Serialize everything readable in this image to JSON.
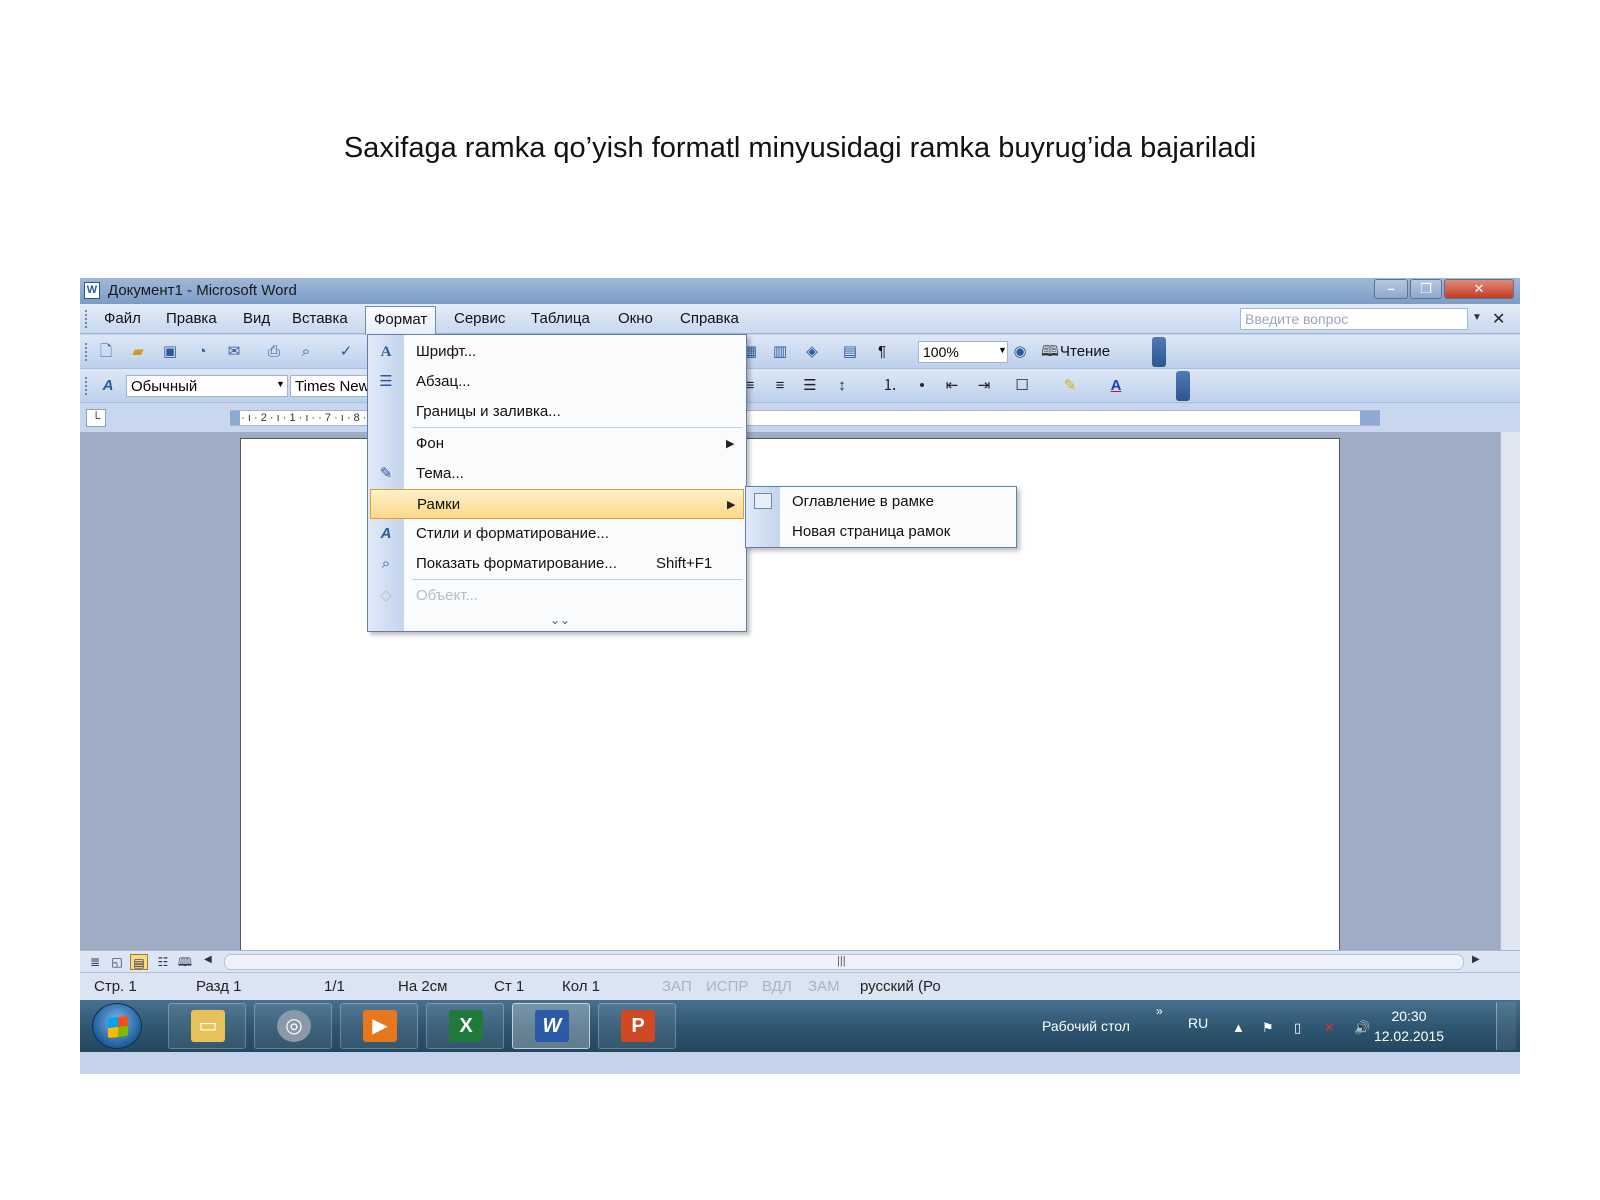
{
  "caption": "Saxifaga ramka qo’yish formatl minyusidagi ramka buyrug’ida bajariladi",
  "window": {
    "title": "Документ1 - Microsoft Word",
    "buttons": {
      "minimize": "–",
      "maximize": "❐",
      "close": "✕"
    }
  },
  "menubar": {
    "items": [
      "Файл",
      "Правка",
      "Вид",
      "Вставка",
      "Формат",
      "Сервис",
      "Таблица",
      "Окно",
      "Справка"
    ],
    "active": "Формат",
    "help_placeholder": "Введите вопрос"
  },
  "toolbar_standard": {
    "zoom": "100%",
    "reading_label": "Чтение",
    "icons": [
      "new-document",
      "open",
      "save",
      "permission",
      "email",
      "print",
      "print-preview",
      "spelling",
      "table",
      "columns",
      "drawing",
      "document-map",
      "show-formatting",
      "help"
    ]
  },
  "toolbar_formatting": {
    "style": "Обычный",
    "font": "Times New Roman",
    "icons": [
      "styles",
      "align-right",
      "justify",
      "line-spacing",
      "numbering",
      "bullets",
      "decrease-indent",
      "increase-indent",
      "borders",
      "highlight",
      "font-color"
    ]
  },
  "ruler": {
    "text": "3 · ı · 2 · ı · 1 · ı ·                                                                                         · 7 · ı · 8 · ı · 9 · ı · 10 · ı · 11 · ı · 12 · ı · 13 · ı · 14 · ı · 15 · ı · 16 · △ · 17 · ı ·"
  },
  "format_menu": {
    "items": [
      {
        "label": "Шрифт...",
        "icon": "font-icon"
      },
      {
        "label": "Абзац...",
        "icon": "paragraph-icon"
      },
      {
        "label": "Границы и заливка...",
        "icon": ""
      },
      {
        "label": "Фон",
        "icon": "",
        "submenu": true
      },
      {
        "label": "Тема...",
        "icon": "theme-icon"
      },
      {
        "label": "Рамки",
        "icon": "",
        "submenu": true,
        "highlighted": true
      },
      {
        "label": "Стили и форматирование...",
        "icon": "styles-icon"
      },
      {
        "label": "Показать форматирование...",
        "icon": "reveal-formatting-icon",
        "shortcut": "Shift+F1"
      },
      {
        "label": "Объект...",
        "icon": "object-icon",
        "disabled": true
      }
    ]
  },
  "frames_submenu": {
    "items": [
      "Оглавление в рамке",
      "Новая страница рамок"
    ]
  },
  "status_bar": {
    "page": "Стр. 1",
    "section": "Разд 1",
    "pages": "1/1",
    "at": "На 2см",
    "line": "Ст 1",
    "col": "Кол 1",
    "rec": "ЗАП",
    "trk": "ИСПР",
    "ext": "ВДЛ",
    "ovr": "ЗАМ",
    "language": "русский (Ро"
  },
  "taskbar": {
    "desktop_label": "Рабочий стол",
    "language": "RU",
    "time": "20:30",
    "date": "12.02.2015",
    "apps": [
      "explorer",
      "media-center",
      "media-player",
      "excel",
      "word",
      "powerpoint"
    ]
  },
  "colors": {
    "menu_highlight": "#fbd88a",
    "titlebar": "#7c9cc6",
    "taskbar": "#2e5570"
  }
}
